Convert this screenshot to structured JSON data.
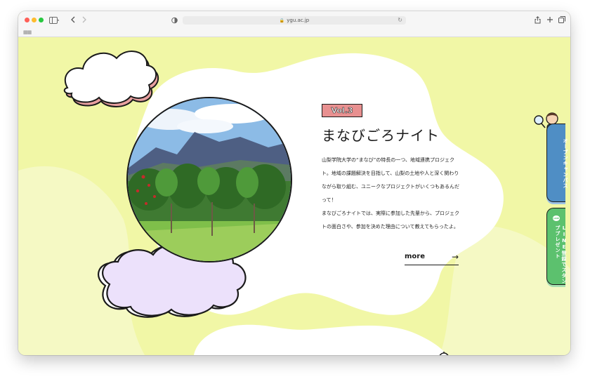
{
  "browser": {
    "url": "ygu.ac.jp",
    "icons": [
      "sidebar-icon",
      "back-icon",
      "forward-icon",
      "shield-icon",
      "lock-icon",
      "reload-icon",
      "share-icon",
      "new-tab-icon",
      "tabs-overview-icon",
      "grid-icon"
    ]
  },
  "feature": {
    "badge": "Vol.3",
    "title": "まなびごろナイト",
    "paragraphs": [
      "山梨学院大学の“まなび”の特長の一つ、地域連携プロジェクト。地域の課題解決を目指して、山梨の土地や人と深く関わりながら取り組む、ユニークなプロジェクトがいくつもあるんだって！",
      "まなびごろナイトでは、実際に参加した先輩から、プロジェクトの面白さや、参加を決めた理由について教えてもらったよ。"
    ],
    "more_label": "more",
    "more_arrow": "→"
  },
  "side_tabs": {
    "open_campus": "オープンキャンパス",
    "line_icon": "LINE",
    "line_signup": "LINE登録でスタンププレゼント"
  },
  "colors": {
    "page_bg": "#f1f7a6",
    "blob": "#ffffff",
    "badge": "#e89090",
    "cloud_shadow_pink": "#e8a0a0",
    "cloud_lavender": "#ece1fb",
    "tab_blue": "#4f8ec5",
    "tab_green": "#5cc16e"
  }
}
